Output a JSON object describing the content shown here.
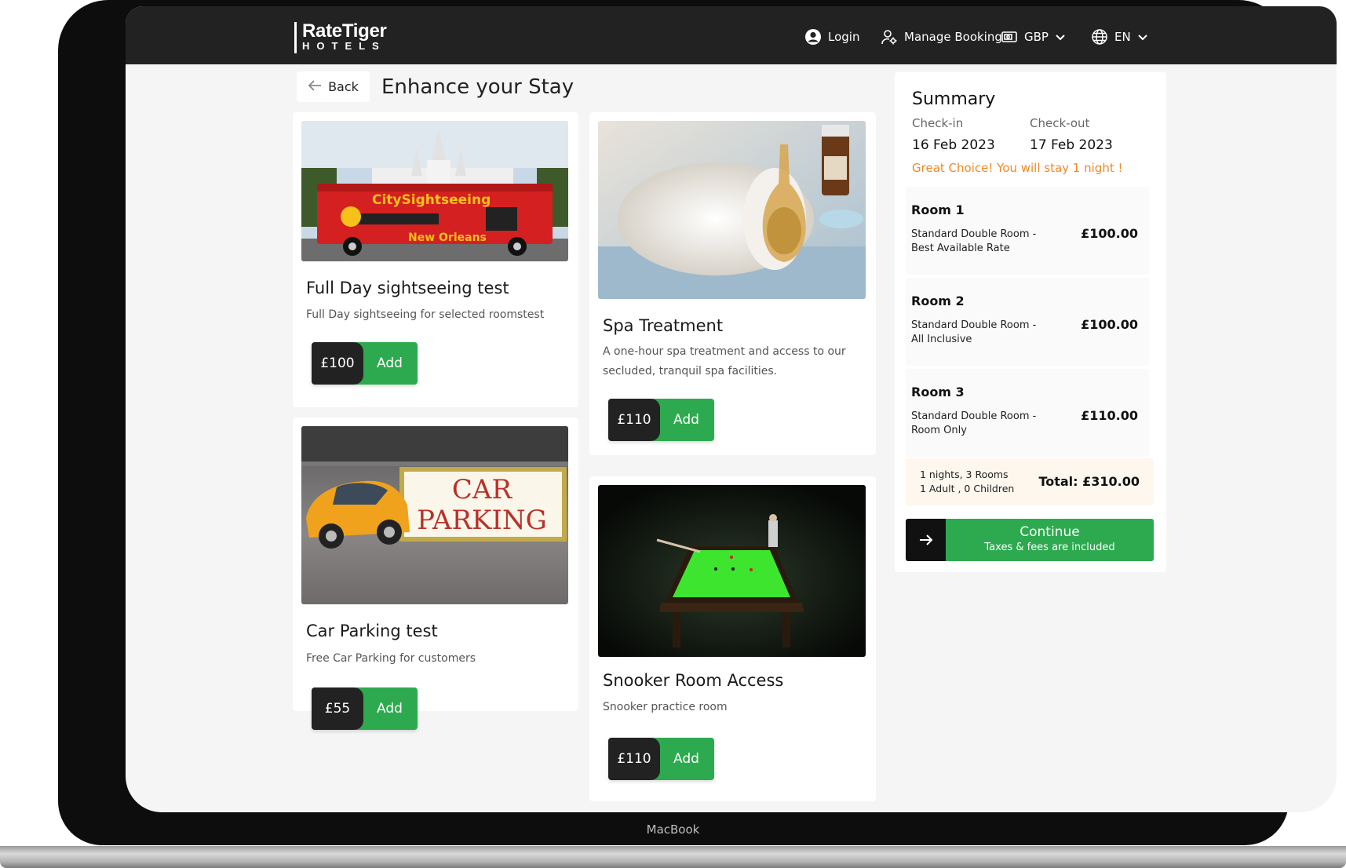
{
  "device": {
    "label": "MacBook"
  },
  "header": {
    "logo_line1": "RateTiger",
    "logo_line2": "HOTELS",
    "login_label": "Login",
    "manage_booking_label": "Manage Booking",
    "currency_label": "GBP",
    "language_label": "EN"
  },
  "page": {
    "back_label": "Back",
    "title": "Enhance your Stay"
  },
  "extras": [
    {
      "title": "Full Day sightseeing test",
      "desc": "Full Day sightseeing for selected roomstest",
      "price": "£100",
      "add_label": "Add"
    },
    {
      "title": "Spa Treatment",
      "desc": "A one-hour spa treatment and access to our secluded, tranquil spa facilities.",
      "price": "£110",
      "add_label": "Add"
    },
    {
      "title": "Car Parking test",
      "desc": "Free Car Parking for customers",
      "price": "£55",
      "add_label": "Add"
    },
    {
      "title": "Snooker Room Access",
      "desc": "Snooker practice room",
      "price": "£110",
      "add_label": "Add"
    }
  ],
  "image_text": {
    "bus_line1": "CitySightseeing",
    "bus_line2": "New Orleans",
    "parking_line1": "CAR",
    "parking_line2": "PARKING"
  },
  "summary": {
    "title": "Summary",
    "checkin_label": "Check-in",
    "checkout_label": "Check-out",
    "checkin_date": "16 Feb 2023",
    "checkout_date": "17 Feb 2023",
    "stay_note": "Great Choice! You will stay 1 night !",
    "rooms": [
      {
        "name": "Room 1",
        "desc_line1": "Standard Double Room -",
        "desc_line2": "Best Available Rate",
        "price": "£100.00"
      },
      {
        "name": "Room 2",
        "desc_line1": "Standard Double Room -",
        "desc_line2": "All Inclusive",
        "price": "£100.00"
      },
      {
        "name": "Room 3",
        "desc_line1": "Standard Double Room -",
        "desc_line2": "Room Only",
        "price": "£110.00"
      }
    ],
    "nights_rooms": "1 nights, 3 Rooms",
    "guests": "1 Adult , 0 Children",
    "total": "Total: £310.00",
    "continue_label": "Continue",
    "continue_sub": "Taxes & fees are included"
  },
  "colors": {
    "accent_green": "#2daa4f",
    "header_bg": "#222222",
    "note_orange": "#f08a24"
  }
}
